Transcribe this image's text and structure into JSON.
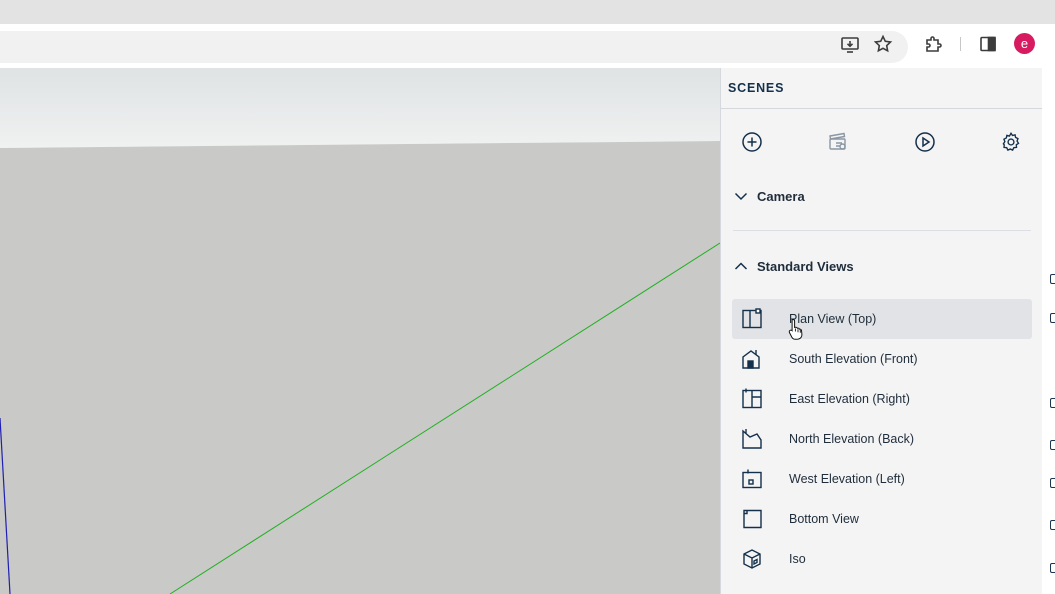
{
  "colors": {
    "accent_navy": "#14304a",
    "avatar_bg": "#d81b60",
    "axis_green": "#22b022",
    "axis_blue": "#1f1fb0",
    "ground": "#c9c9c8",
    "sky": "#e8eaea"
  },
  "browser": {
    "toolbar_icons": [
      "install-app-icon",
      "bookmark-star-icon",
      "extensions-puzzle-icon",
      "side-panel-icon"
    ],
    "profile_initial": "e"
  },
  "panel": {
    "title": "SCENES",
    "tools": [
      "add-scene-icon",
      "scene-clapper-icon",
      "play-icon",
      "settings-gear-icon"
    ],
    "sections": {
      "camera": {
        "label": "Camera",
        "expanded": false
      },
      "standard_views": {
        "label": "Standard Views",
        "expanded": true
      }
    },
    "views": [
      {
        "label": "Plan View (Top)",
        "icon": "plan-view-icon",
        "hovered": true
      },
      {
        "label": "South Elevation (Front)",
        "icon": "south-elevation-icon"
      },
      {
        "label": "East Elevation (Right)",
        "icon": "east-elevation-icon"
      },
      {
        "label": "North Elevation (Back)",
        "icon": "north-elevation-icon"
      },
      {
        "label": "West Elevation (Left)",
        "icon": "west-elevation-icon"
      },
      {
        "label": "Bottom View",
        "icon": "bottom-view-icon"
      },
      {
        "label": "Iso",
        "icon": "iso-view-icon"
      }
    ]
  }
}
